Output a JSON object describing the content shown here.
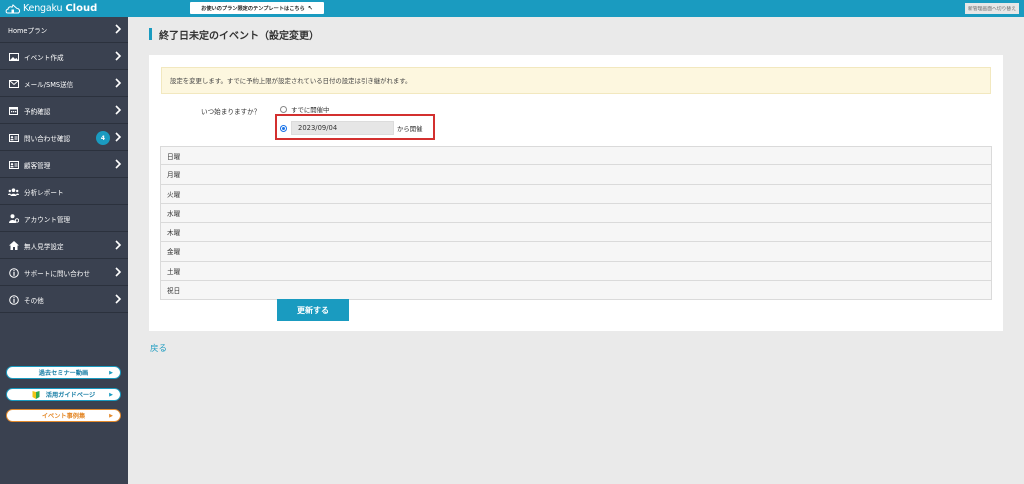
{
  "header": {
    "logo_light": "Kengaku",
    "logo_bold": "Cloud",
    "template_banner": "お使いのプラン限定のテンプレートはこちら",
    "switch_link": "新管理画面へ切り替え"
  },
  "sidebar": {
    "items": [
      {
        "label": "Homeプラン",
        "icon": "none",
        "chevron": true
      },
      {
        "label": "イベント作成",
        "icon": "image-icon",
        "chevron": true
      },
      {
        "label": "メール/SMS送信",
        "icon": "envelope-icon",
        "chevron": true
      },
      {
        "label": "予約確認",
        "icon": "calendar-icon",
        "chevron": true
      },
      {
        "label": "問い合わせ確認",
        "icon": "id-card-icon",
        "chevron": true,
        "badge": "4"
      },
      {
        "label": "顧客管理",
        "icon": "id-card-icon",
        "chevron": true
      },
      {
        "label": "分析レポート",
        "icon": "users-icon",
        "chevron": false
      },
      {
        "label": "アカウント管理",
        "icon": "user-gear-icon",
        "chevron": false
      },
      {
        "label": "無人見学設定",
        "icon": "home-icon",
        "chevron": true
      },
      {
        "label": "サポートに問い合わせ",
        "icon": "info-circle-icon",
        "chevron": true
      },
      {
        "label": "その他",
        "icon": "info-circle-icon",
        "chevron": true
      }
    ],
    "buttons": [
      {
        "label": "過去セミナー動画"
      },
      {
        "label": "活用ガイドページ"
      },
      {
        "label": "イベント事例集"
      }
    ]
  },
  "main": {
    "title": "終了日未定のイベント（設定変更）",
    "notice": "設定を変更します。すでに予約上限が設定されている日付の設定は引き継がれます。",
    "question": "いつ始まりますか？",
    "option_already": "すでに開催中",
    "start_date": "2023/09/04",
    "start_suffix": "から開催",
    "selected_option": "start_date",
    "days": [
      "日曜",
      "月曜",
      "火曜",
      "水曜",
      "木曜",
      "金曜",
      "土曜",
      "祝日"
    ],
    "update_button": "更新する",
    "back_link": "戻る"
  },
  "colors": {
    "accent": "#1a9bc0",
    "sidebar_bg": "#3a4150",
    "highlight_border": "#d3302f",
    "notice_bg": "#fdf7df",
    "orange": "#e48a2c"
  }
}
